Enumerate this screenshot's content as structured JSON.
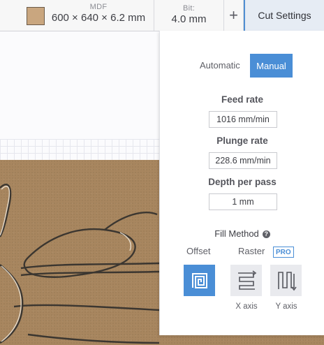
{
  "toolbar": {
    "material_label": "MDF",
    "material_dims": "600 × 640 × 6.2 mm",
    "material_color": "#c9a67f",
    "bit_label": "Bit:",
    "bit_value": "4.0 mm",
    "add_symbol": "+",
    "cut_settings_label": "Cut Settings"
  },
  "panel": {
    "mode_automatic": "Automatic",
    "mode_manual": "Manual",
    "active_mode": "Manual",
    "feed_rate_label": "Feed rate",
    "feed_rate_value": "1016 mm/min",
    "plunge_rate_label": "Plunge rate",
    "plunge_rate_value": "228.6 mm/min",
    "depth_label": "Depth per pass",
    "depth_value": "1 mm",
    "fill_method_label": "Fill Method",
    "help_symbol": "?",
    "offset_label": "Offset",
    "raster_label": "Raster",
    "pro_badge": "PRO",
    "x_axis_label": "X axis",
    "y_axis_label": "Y axis",
    "selected_fill": "Offset"
  },
  "colors": {
    "accent": "#4a8ed6",
    "board": "#a8865f"
  },
  "icons": {
    "offset": "offset-spiral-icon",
    "x_axis": "raster-x-icon",
    "y_axis": "raster-y-icon",
    "help": "help-icon"
  }
}
